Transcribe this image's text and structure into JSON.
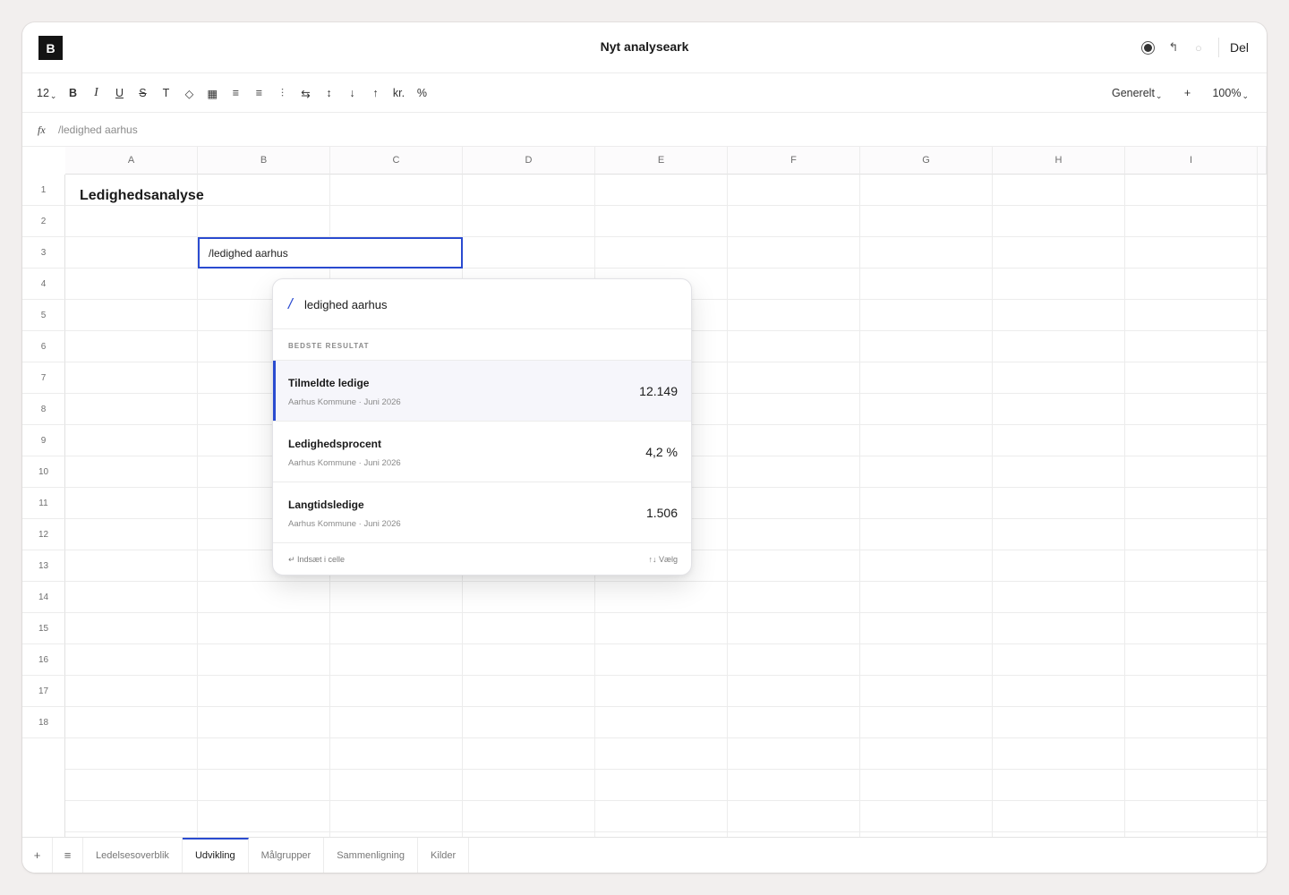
{
  "app": {
    "logo_letter": "B",
    "doc_title": "Nyt analyseark",
    "share_label": "Del",
    "accent_color": "#2a4bd0"
  },
  "toolbar": {
    "font_size": "12",
    "bold": "B",
    "italic": "I",
    "underline": "U",
    "strike": "S",
    "text_type": "T",
    "fill": "◇",
    "borders": "▦",
    "align_left": "≡",
    "align_center": "≡",
    "wrap": "⫶",
    "merge": "⇆",
    "row_height": "↕",
    "sort_desc": "↓",
    "sort_asc": "↑",
    "currency": "kr.",
    "percent": "%",
    "number_format": "Generelt",
    "add": "+",
    "zoom": "100%"
  },
  "formula": {
    "fx_label": "fx",
    "value": "/ledighed aarhus"
  },
  "grid": {
    "columns": [
      "A",
      "B",
      "C",
      "D",
      "E",
      "F",
      "G",
      "H",
      "I"
    ],
    "rows": [
      "1",
      "2",
      "3",
      "4",
      "5",
      "6",
      "7",
      "8",
      "9",
      "10",
      "11",
      "12",
      "13",
      "14",
      "15",
      "16",
      "17",
      "18"
    ],
    "cell_a1": "Ledighedsanalyse",
    "active_cell_value": "/ledighed aarhus"
  },
  "popup": {
    "slash": "/",
    "query": "ledighed aarhus",
    "section_label": "BEDSTE RESULTAT",
    "results": [
      {
        "title": "Tilmeldte ledige",
        "subtitle": "Aarhus Kommune · Juni 2026",
        "value": "12.149"
      },
      {
        "title": "Ledighedsprocent",
        "subtitle": "Aarhus Kommune · Juni 2026",
        "value": "4,2 %"
      },
      {
        "title": "Langtidsledige",
        "subtitle": "Aarhus Kommune · Juni 2026",
        "value": "1.506"
      }
    ],
    "footer_left": "↵ Indsæt i celle",
    "footer_right": "↑↓ Vælg"
  },
  "sheets": {
    "add_icon": "+",
    "menu_icon": "≡",
    "tabs": [
      "Ledelsesoverblik",
      "Udvikling",
      "Målgrupper",
      "Sammenligning",
      "Kilder"
    ],
    "active": "Udvikling"
  }
}
